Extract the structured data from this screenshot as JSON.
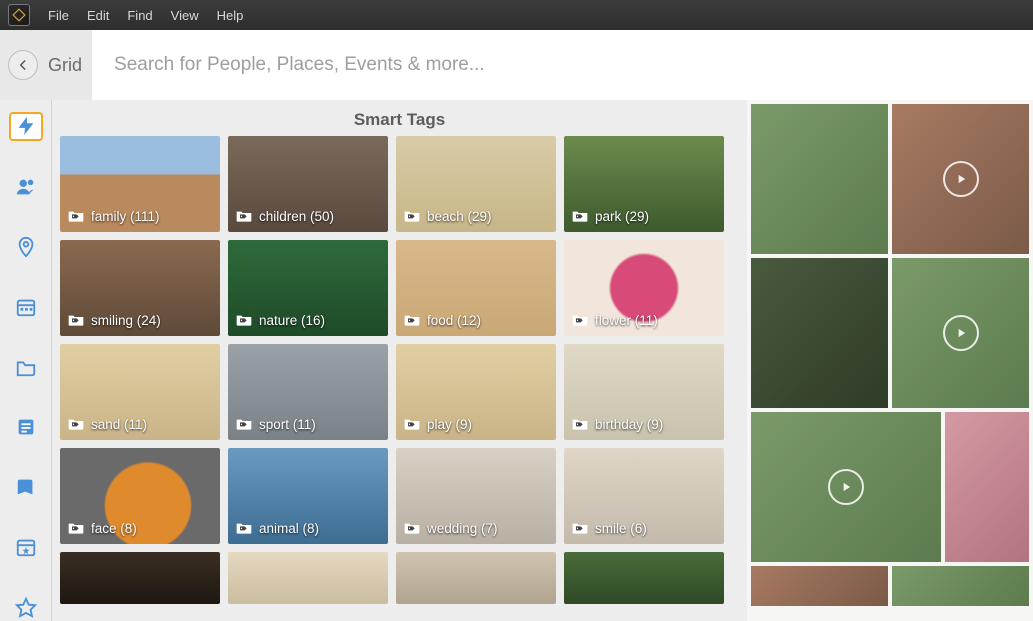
{
  "menu": {
    "file": "File",
    "edit": "Edit",
    "find": "Find",
    "view": "View",
    "help": "Help"
  },
  "header": {
    "mode_label": "Grid",
    "search_placeholder": "Search for People, Places, Events & more..."
  },
  "panel": {
    "title": "Smart Tags"
  },
  "tags": [
    {
      "label": "family",
      "count": 111,
      "thumb": "th-warm-city"
    },
    {
      "label": "children",
      "count": 50,
      "thumb": "th-indoor"
    },
    {
      "label": "beach",
      "count": 29,
      "thumb": "th-beach"
    },
    {
      "label": "park",
      "count": 29,
      "thumb": "th-park"
    },
    {
      "label": "smiling",
      "count": 24,
      "thumb": "th-portrait"
    },
    {
      "label": "nature",
      "count": 16,
      "thumb": "th-leaf"
    },
    {
      "label": "food",
      "count": 12,
      "thumb": "th-food"
    },
    {
      "label": "flower",
      "count": 11,
      "thumb": "th-flower"
    },
    {
      "label": "sand",
      "count": 11,
      "thumb": "th-sand"
    },
    {
      "label": "sport",
      "count": 11,
      "thumb": "th-wall"
    },
    {
      "label": "play",
      "count": 9,
      "thumb": "th-sand"
    },
    {
      "label": "birthday",
      "count": 9,
      "thumb": "th-balloon"
    },
    {
      "label": "face",
      "count": 8,
      "thumb": "th-pumpkin"
    },
    {
      "label": "animal",
      "count": 8,
      "thumb": "th-water"
    },
    {
      "label": "wedding",
      "count": 7,
      "thumb": "th-wed"
    },
    {
      "label": "smile",
      "count": 6,
      "thumb": "th-smile"
    }
  ],
  "partial_tags": [
    {
      "thumb": "th-darkmix"
    },
    {
      "thumb": "th-brightmix"
    },
    {
      "thumb": "th-sports"
    },
    {
      "thumb": "th-xmas"
    }
  ],
  "sidebar": [
    {
      "id": "auto",
      "selected": true
    },
    {
      "id": "people",
      "selected": false
    },
    {
      "id": "places",
      "selected": false
    },
    {
      "id": "date",
      "selected": false
    },
    {
      "id": "folders",
      "selected": false
    },
    {
      "id": "keywords",
      "selected": false
    },
    {
      "id": "albums",
      "selected": false
    },
    {
      "id": "events",
      "selected": false
    },
    {
      "id": "ratings",
      "selected": false
    }
  ],
  "colors": {
    "accent_blue": "#4a90d9",
    "highlight_orange": "#f5a623"
  }
}
